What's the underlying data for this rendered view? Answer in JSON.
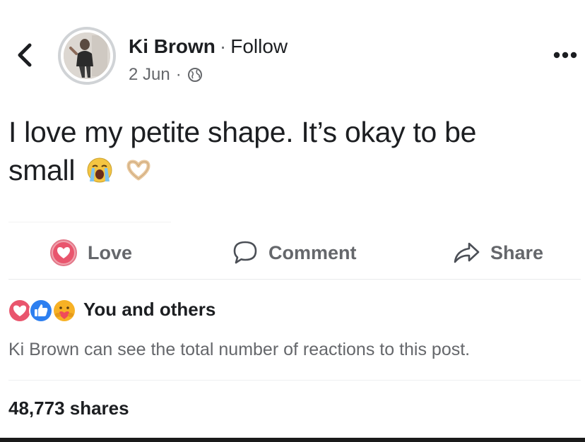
{
  "post": {
    "author": "Ki Brown",
    "separator": "·",
    "follow_label": "Follow",
    "date": "2 Jun",
    "text_line1": "I love my petite shape. It’s okay to be",
    "text_line2": "small"
  },
  "icons": {
    "back": "chevron-left-icon",
    "more": "more-dots-icon",
    "privacy": "globe-icon",
    "emojis": [
      "loudly-crying-face",
      "heart-hands"
    ]
  },
  "actions": {
    "love_label": "Love",
    "comment_label": "Comment",
    "share_label": "Share"
  },
  "reactions": {
    "icons": [
      "love",
      "like",
      "care"
    ],
    "summary": "You and others",
    "note": "Ki Brown can see the total number of reactions to this post."
  },
  "shares": {
    "count_label": "48,773 shares"
  },
  "colors": {
    "text": "#1c1e21",
    "muted": "#65676b",
    "love": "#f33e58",
    "like": "#1877f2",
    "care": "#f7b125"
  }
}
